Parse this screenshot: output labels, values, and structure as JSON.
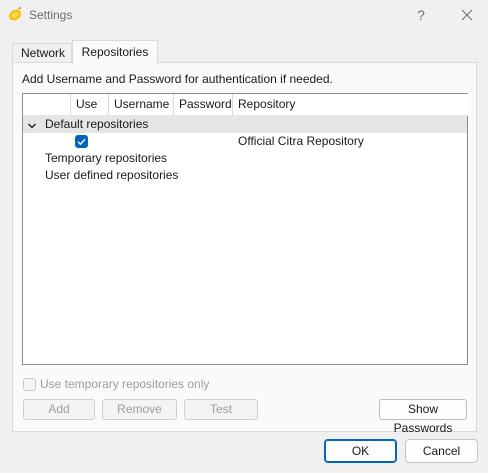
{
  "window": {
    "title": "Settings",
    "help_glyph": "?",
    "icon": "citra-lemon-icon"
  },
  "tabs": [
    {
      "label": "Network",
      "active": false
    },
    {
      "label": "Repositories",
      "active": true
    }
  ],
  "panel": {
    "hint": "Add Username and Password for authentication if needed.",
    "columns": [
      "Use",
      "Username",
      "Password",
      "Repository"
    ],
    "tree": {
      "default_group": "Default repositories",
      "default_items": [
        {
          "use": true,
          "username": "",
          "password": "",
          "repository": "Official Citra Repository"
        }
      ],
      "temporary_group": "Temporary repositories",
      "user_group": "User defined repositories"
    },
    "temporary_only_label": "Use temporary repositories only",
    "buttons": {
      "add": "Add",
      "remove": "Remove",
      "test": "Test",
      "show_passwords": "Show Passwords"
    }
  },
  "footer": {
    "ok": "OK",
    "cancel": "Cancel"
  },
  "colors": {
    "accent": "#0067c0",
    "background": "#f0f0f0",
    "selected_row": "#e5e5e5"
  }
}
